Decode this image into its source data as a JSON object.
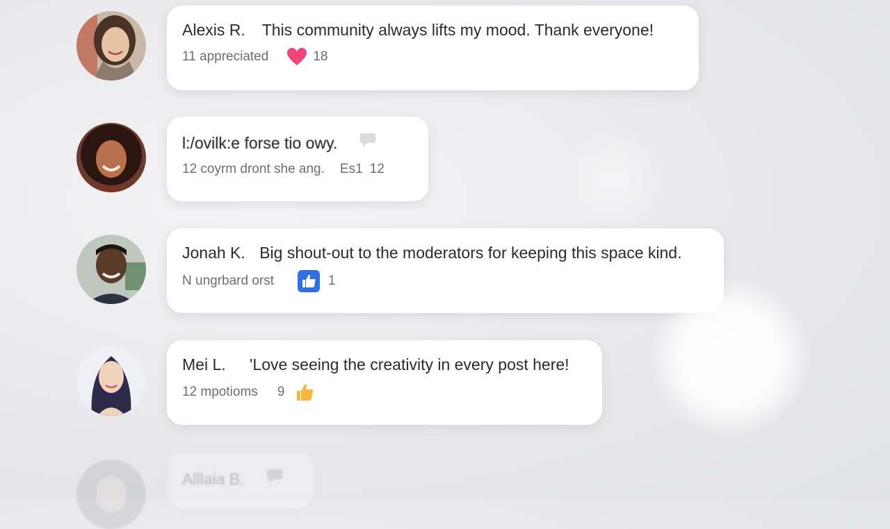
{
  "colors": {
    "heart": "#f0457a",
    "like_blue": "#2f6fe0",
    "like_yellow": "#f6b93b"
  },
  "comments": [
    {
      "name": "Alexis R.",
      "text": "This community always lifts my mood. Thank everyone!",
      "meta": "11 appreciated",
      "reaction_icon": "heart-icon",
      "count": "18"
    },
    {
      "name": "",
      "text": "l:/ovilk:e forse tio owy.",
      "meta": "12 coyrm dront she ang.",
      "extra": "Es1",
      "reaction_icon": "speech-bubble-icon",
      "count": "12"
    },
    {
      "name": "Jonah K.",
      "text": "Big shout-out to the moderators for keeping this space kind.",
      "meta": "N ungrbard orst",
      "reaction_icon": "thumbs-up-blue-icon",
      "count": "1"
    },
    {
      "name": "Mei L.",
      "text": "'Love seeing the creativity in every post here!",
      "meta": "12 mpotioms",
      "count_before": "9",
      "reaction_icon": "thumbs-up-yellow-icon"
    },
    {
      "name": "Alllaia B.",
      "reaction_icon": "speech-bubble-icon"
    }
  ]
}
